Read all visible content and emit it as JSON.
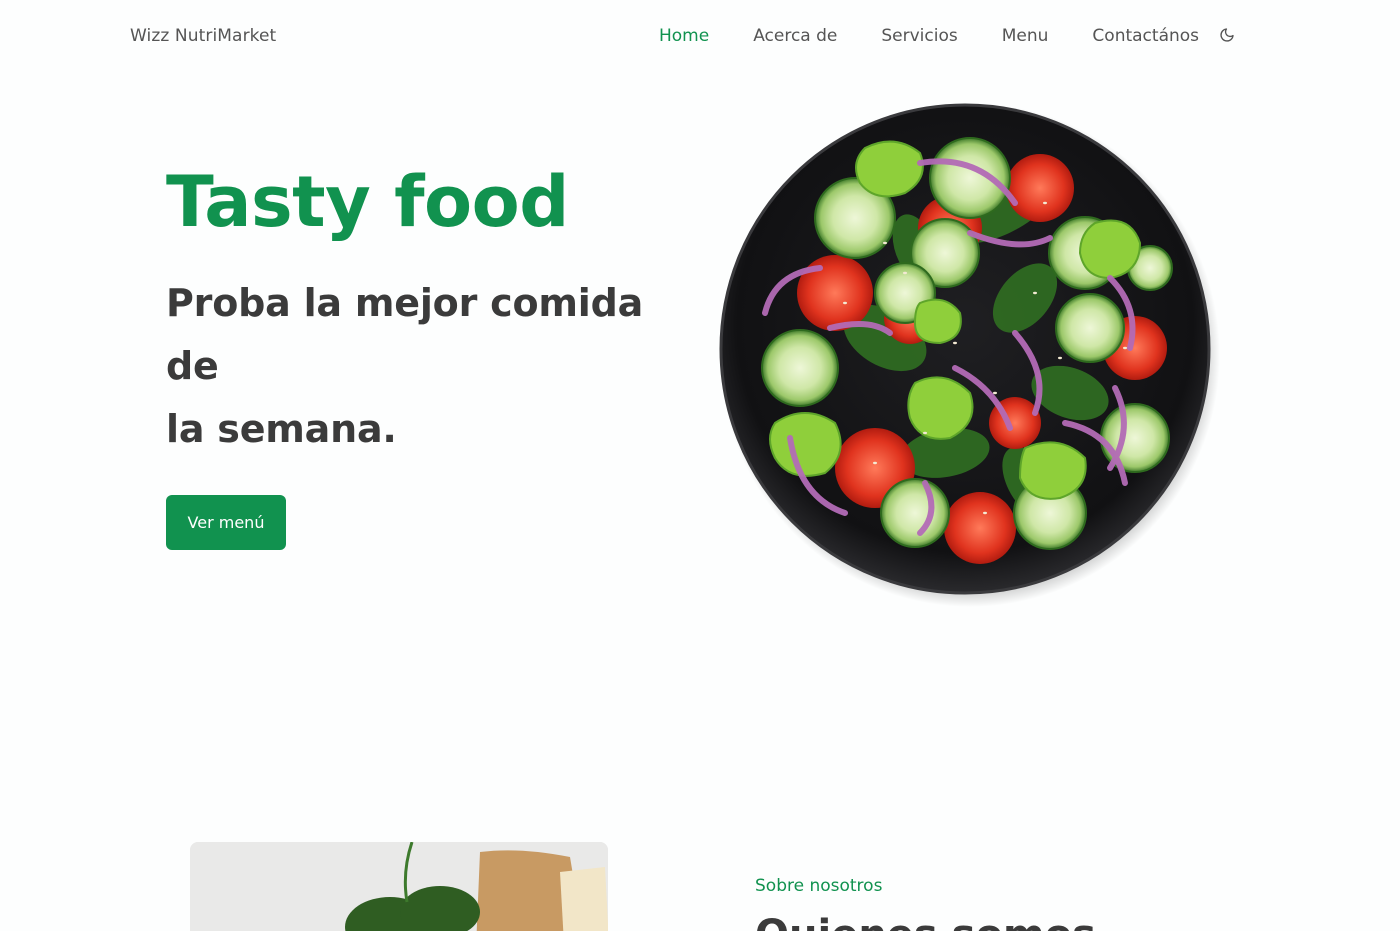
{
  "brand": {
    "name": "Wizz NutriMarket",
    "accent": "#11924f"
  },
  "nav": {
    "items": [
      {
        "label": "Home",
        "active": true
      },
      {
        "label": "Acerca de",
        "active": false
      },
      {
        "label": "Servicios",
        "active": false
      },
      {
        "label": "Menu",
        "active": false
      },
      {
        "label": "Contactános",
        "active": false
      }
    ],
    "theme_toggle_icon": "moon-icon"
  },
  "hero": {
    "title": "Tasty food",
    "subtitle_lines": [
      "Proba la mejor comida",
      "de",
      "la semana."
    ],
    "button_label": "Ver menú",
    "image_icon": "salad-plate-image"
  },
  "about": {
    "subtitle": "Sobre nosotros",
    "title": "Quienes somos"
  }
}
